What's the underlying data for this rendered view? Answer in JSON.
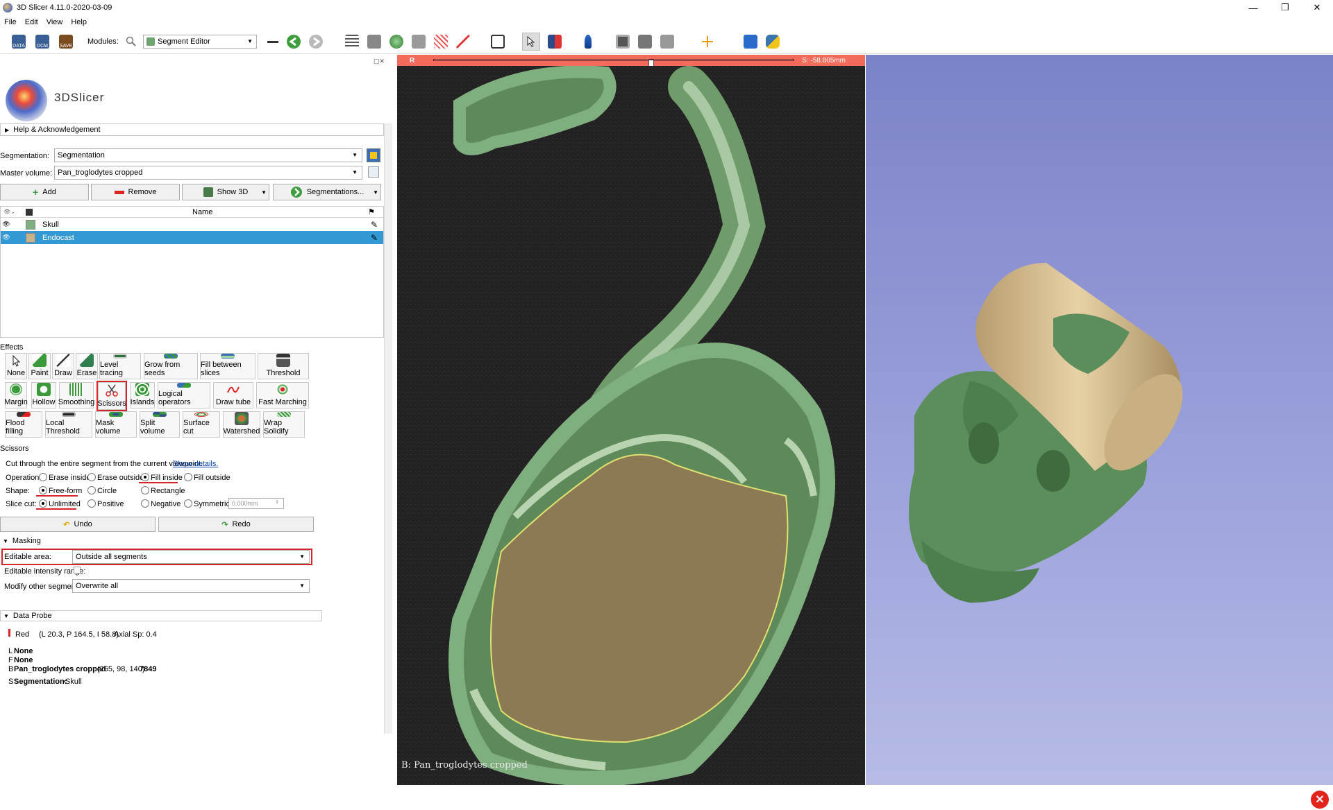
{
  "window": {
    "title": "3D Slicer 4.11.0-2020-03-09",
    "min": "—",
    "max": "❐",
    "close": "✕"
  },
  "menu": [
    "File",
    "Edit",
    "View",
    "Help"
  ],
  "toolbar": {
    "data_label": "DATA",
    "dcm_label": "DCM",
    "save_label": "SAVE",
    "modules_label": "Modules:",
    "module_selected": "Segment Editor"
  },
  "logo_text": "3DSlicer",
  "help_section": "Help & Acknowledgement",
  "segmentation": {
    "label": "Segmentation:",
    "value": "Segmentation"
  },
  "master_volume": {
    "label": "Master volume:",
    "value": "Pan_troglodytes cropped"
  },
  "buttons": {
    "add": "Add",
    "remove": "Remove",
    "show3d": "Show 3D",
    "segmentations": "Segmentations..."
  },
  "table": {
    "name_header": "Name",
    "rows": [
      {
        "name": "Skull",
        "color": "#7fae7f",
        "selected": false
      },
      {
        "name": "Endocast",
        "color": "#c7b38a",
        "selected": true
      }
    ]
  },
  "effects_label": "Effects",
  "effects": [
    [
      "None",
      "Paint",
      "Draw",
      "Erase",
      "Level tracing",
      "Grow from seeds",
      "Fill between slices",
      "Threshold"
    ],
    [
      "Margin",
      "Hollow",
      "Smoothing",
      "Scissors",
      "Islands",
      "Logical operators",
      "Draw tube",
      "Fast Marching"
    ],
    [
      "Flood filling",
      "Local Threshold",
      "Mask volume",
      "Split volume",
      "Surface cut",
      "Watershed",
      "Wrap Solidify"
    ]
  ],
  "scissors": {
    "title": "Scissors",
    "description": "Cut through the entire segment from the current viewpoint...",
    "show_details": "Show details.",
    "operation_label": "Operation:",
    "operations": [
      "Erase inside",
      "Erase outside",
      "Fill inside",
      "Fill outside"
    ],
    "operation_selected": "Fill inside",
    "shape_label": "Shape:",
    "shapes": [
      "Free-form",
      "Circle",
      "Rectangle"
    ],
    "slicecut_label": "Slice cut:",
    "slicecuts": [
      "Unlimited",
      "Positive",
      "Negative",
      "Symmetric"
    ],
    "thickness": "0.000mm"
  },
  "undo": "Undo",
  "redo": "Redo",
  "masking": {
    "title": "Masking",
    "editable_area_label": "Editable area:",
    "editable_area_value": "Outside all segments",
    "intensity_label": "Editable intensity range:",
    "modify_label": "Modify other segments:",
    "modify_value": "Overwrite all"
  },
  "data_probe": {
    "title": "Data Probe",
    "view": "Red",
    "coords": "(L 20.3, P 164.5, I 58.8)",
    "axial": "Axial Sp: 0.4",
    "l_prefix": "L",
    "l_value": "None",
    "f_prefix": "F",
    "f_value": "None",
    "b_prefix": "B",
    "b_name": "Pan_troglodytes cropped",
    "b_ijk": "(265,  98, 140)",
    "b_value": "7849",
    "s_prefix": "S",
    "s_label": "Segmentation:",
    "s_value": "▪Skull"
  },
  "slice_view": {
    "orientation": "R",
    "offset": "S: -58.805mm",
    "caption": "B: Pan_troglodytes cropped"
  },
  "colors": {
    "accent": "#3399d5",
    "highlight": "#d8232a",
    "slice_bar": "#f36b5b",
    "skull": "#7fae7f",
    "endocast": "#c7b38a"
  }
}
